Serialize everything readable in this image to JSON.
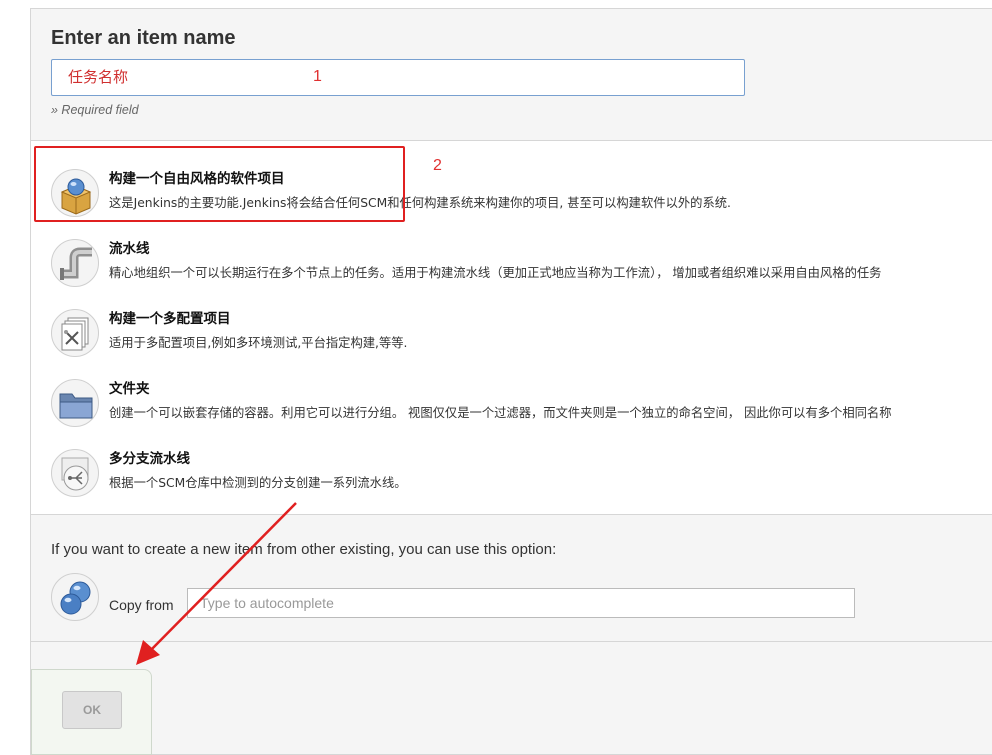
{
  "header": {
    "title": "Enter an item name",
    "name_input_value": "任务名称",
    "required_note": "» Required field"
  },
  "items": [
    {
      "label": "构建一个自由风格的软件项目",
      "desc": "这是Jenkins的主要功能.Jenkins将会结合任何SCM和任何构建系统来构建你的项目, 甚至可以构建软件以外的系统.",
      "icon": "package-box-icon"
    },
    {
      "label": "流水线",
      "desc": "精心地组织一个可以长期运行在多个节点上的任务。适用于构建流水线（更加正式地应当称为工作流）， 增加或者组织难以采用自由风格的任务",
      "icon": "pipe-icon"
    },
    {
      "label": "构建一个多配置项目",
      "desc": "适用于多配置项目,例如多环境测试,平台指定构建,等等.",
      "icon": "multi-config-icon"
    },
    {
      "label": "文件夹",
      "desc": "创建一个可以嵌套存储的容器。利用它可以进行分组。 视图仅仅是一个过滤器，而文件夹则是一个独立的命名空间， 因此你可以有多个相同名称",
      "icon": "folder-icon"
    },
    {
      "label": "多分支流水线",
      "desc": "根据一个SCM仓库中检测到的分支创建一系列流水线。",
      "icon": "branch-icon"
    }
  ],
  "copy": {
    "text": "If you want to create a new item from other existing, you can use this option:",
    "label": "Copy from",
    "placeholder": "Type to autocomplete",
    "icon": "copy-spheres-icon"
  },
  "footer": {
    "ok_label": "OK"
  },
  "annotations": {
    "num1": "1",
    "num2": "2",
    "color": "#e02020"
  }
}
